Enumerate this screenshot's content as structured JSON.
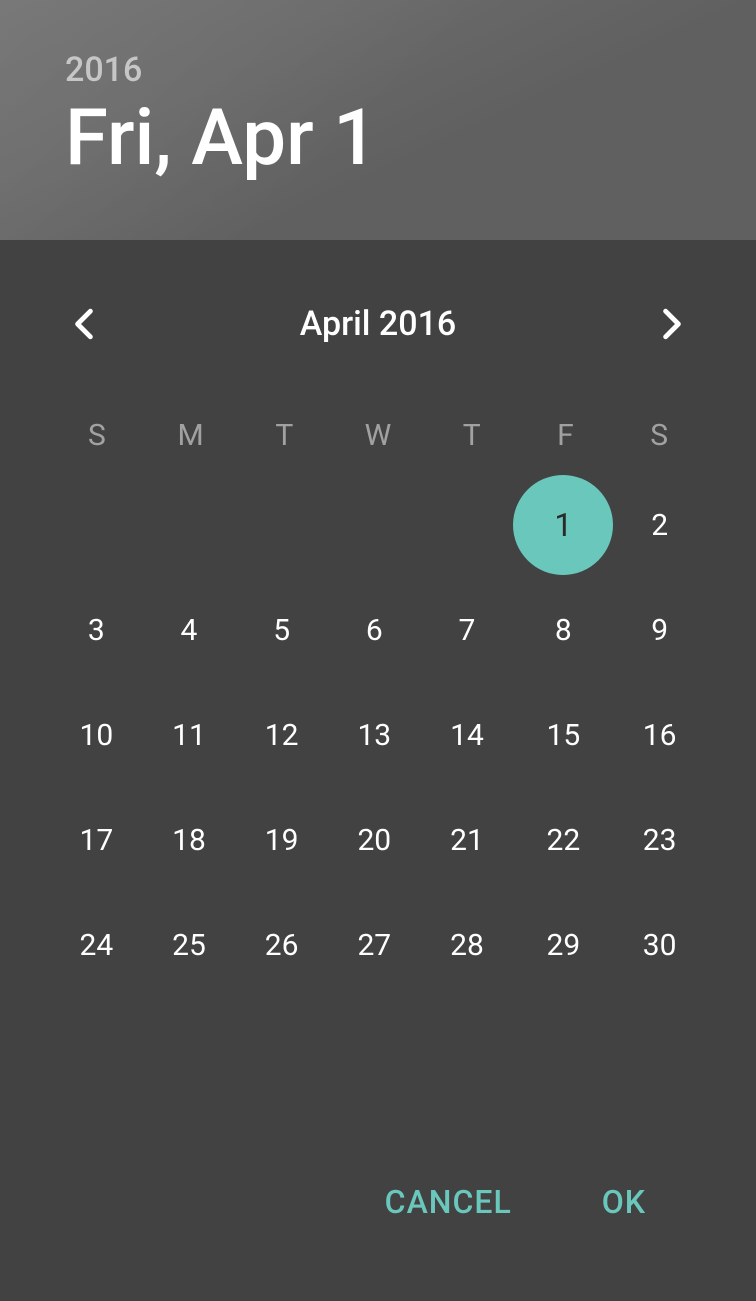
{
  "header": {
    "year": "2016",
    "date": "Fri, Apr 1"
  },
  "calendar": {
    "monthYear": "April 2016",
    "dayHeaders": [
      "S",
      "M",
      "T",
      "W",
      "T",
      "F",
      "S"
    ],
    "startOffset": 5,
    "daysInMonth": 30,
    "selectedDay": 1
  },
  "actions": {
    "cancel": "CANCEL",
    "ok": "OK"
  }
}
